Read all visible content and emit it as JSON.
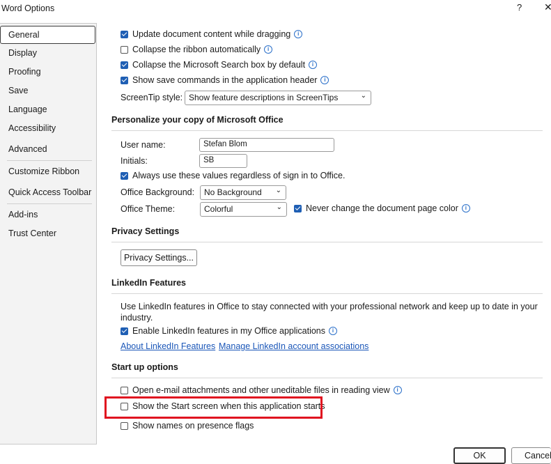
{
  "window": {
    "title": "Word Options",
    "help": "?",
    "close": "✕"
  },
  "sidebar": {
    "items": [
      {
        "label": "General"
      },
      {
        "label": "Display"
      },
      {
        "label": "Proofing"
      },
      {
        "label": "Save"
      },
      {
        "label": "Language"
      },
      {
        "label": "Accessibility"
      },
      {
        "label": "Advanced"
      },
      {
        "label": "Customize Ribbon"
      },
      {
        "label": "Quick Access Toolbar"
      },
      {
        "label": "Add-ins"
      },
      {
        "label": "Trust Center"
      }
    ]
  },
  "ui_options": {
    "update_content": "Update document content while dragging",
    "collapse_ribbon": "Collapse the ribbon automatically",
    "collapse_search": "Collapse the Microsoft Search box by default",
    "show_save": "Show save commands in the application header",
    "screentip_label": "ScreenTip style:",
    "screentip_value": "Show feature descriptions in ScreenTips",
    "checked": {
      "update_content": true,
      "collapse_ribbon": false,
      "collapse_search": true,
      "show_save": true
    }
  },
  "personalize": {
    "heading": "Personalize your copy of Microsoft Office",
    "username_label": "User name:",
    "username_value": "Stefan Blom",
    "initials_label": "Initials:",
    "initials_value": "SB",
    "always_use": "Always use these values regardless of sign in to Office.",
    "background_label": "Office Background:",
    "background_value": "No Background",
    "theme_label": "Office Theme:",
    "theme_value": "Colorful",
    "never_change": "Never change the document page color"
  },
  "privacy": {
    "heading": "Privacy Settings",
    "button": "Privacy Settings..."
  },
  "linkedin": {
    "heading": "LinkedIn Features",
    "description_line1": "Use LinkedIn features in Office to stay connected with your professional network and keep up to date in your",
    "description_line2": "industry.",
    "enable": "Enable LinkedIn features in my Office applications",
    "about_link": "About LinkedIn Features",
    "manage_link": "Manage LinkedIn account associations"
  },
  "startup": {
    "heading": "Start up options",
    "open_attachments": "Open e-mail attachments and other uneditable files in reading view",
    "show_start": "Show the Start screen when this application starts",
    "show_names": "Show names on presence flags"
  },
  "footer": {
    "ok": "OK",
    "cancel": "Cancel"
  },
  "colors": {
    "accent": "#1f5fb4",
    "highlight": "#e0121f",
    "link": "#1a56b8"
  }
}
